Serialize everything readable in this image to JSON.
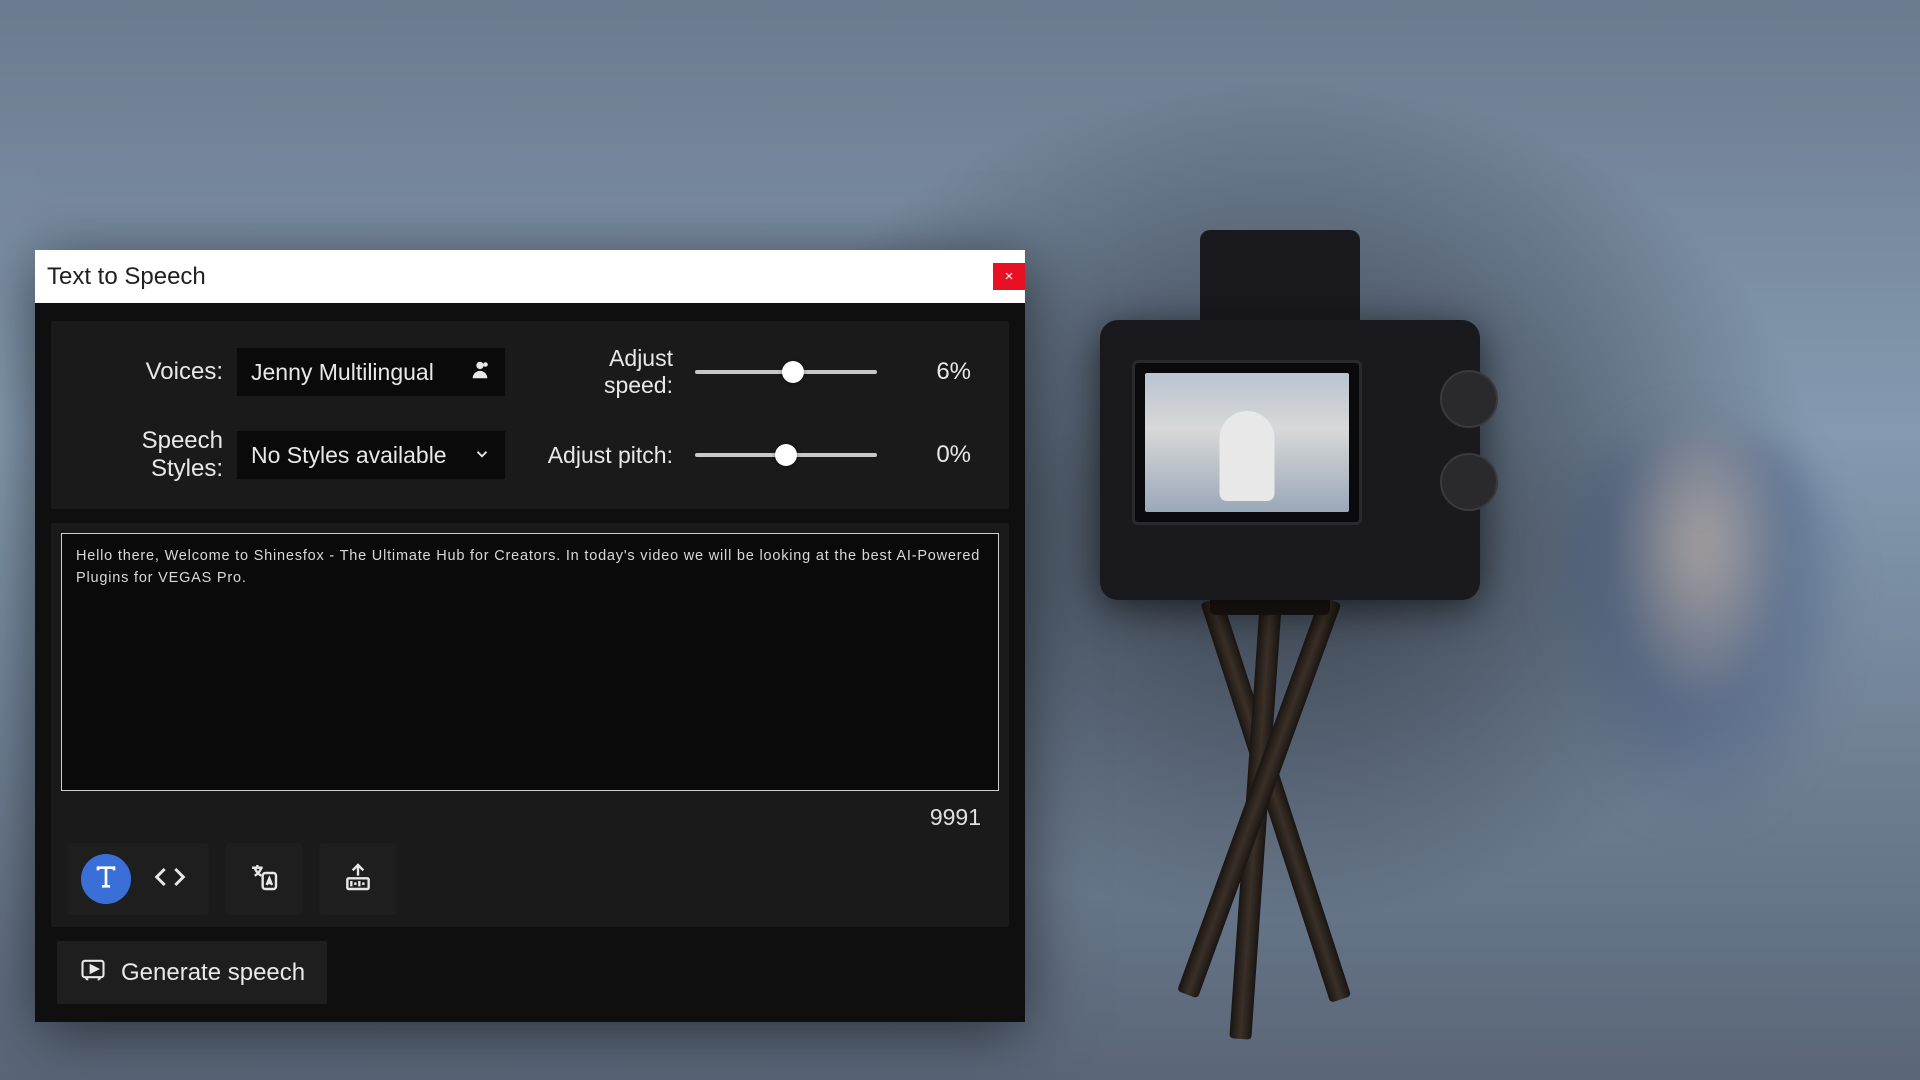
{
  "dialog": {
    "title": "Text to Speech",
    "close_icon": "×"
  },
  "controls": {
    "voices_label": "Voices:",
    "voices_value": "Jenny Multilingual",
    "styles_label": "Speech Styles:",
    "styles_value": "No Styles available",
    "speed_label": "Adjust speed:",
    "speed_value": "6%",
    "speed_percent": 54,
    "pitch_label": "Adjust pitch:",
    "pitch_value": "0%",
    "pitch_percent": 50
  },
  "text": {
    "content": "Hello there, Welcome to Shinesfox - The Ultimate Hub for Creators. In today's video we will be looking at the best AI-Powered Plugins for VEGAS Pro.",
    "char_count": "9991"
  },
  "actions": {
    "generate_label": "Generate speech"
  }
}
